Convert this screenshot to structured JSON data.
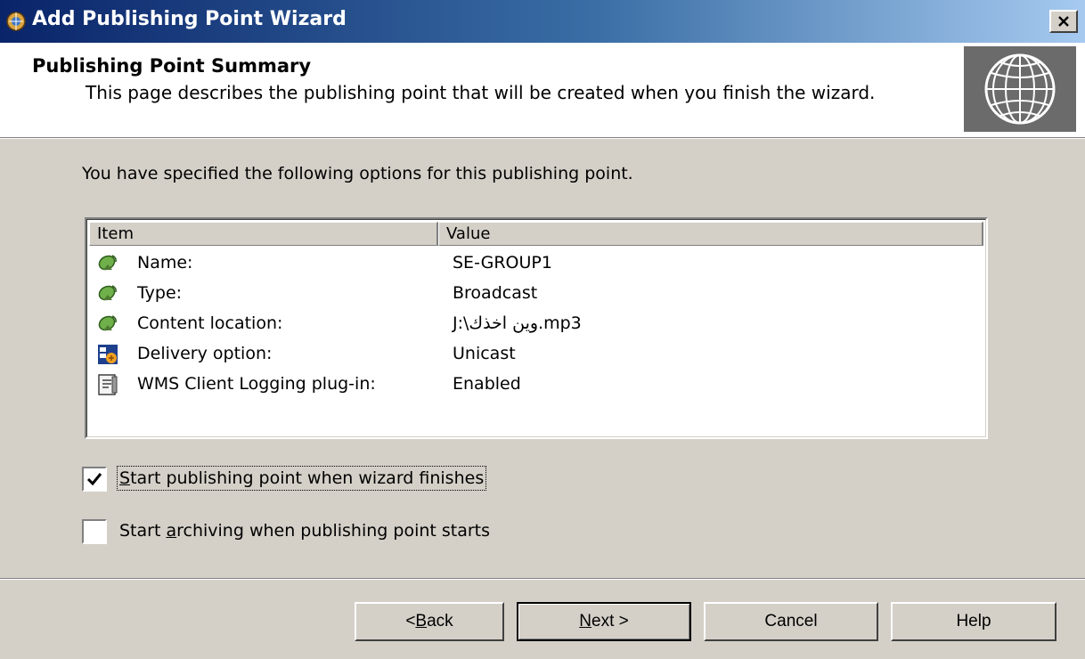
{
  "window": {
    "title": "Add Publishing Point Wizard",
    "close_label": "×"
  },
  "header": {
    "title": "Publishing Point Summary",
    "description": "This page describes the publishing point that will be created when you finish the wizard."
  },
  "intro_text": "You have specified the following options for this publishing point.",
  "summary_list": {
    "columns": [
      "Item",
      "Value"
    ],
    "rows": [
      {
        "label": "Name:",
        "value": "SE-GROUP1",
        "icon": "satellite-dish-icon"
      },
      {
        "label": "Type:",
        "value": "Broadcast",
        "icon": "satellite-dish-icon"
      },
      {
        "label": "Content location:",
        "value": "J:\\وين اخذك.mp3",
        "icon": "satellite-dish-icon"
      },
      {
        "label": "Delivery option:",
        "value": "Unicast",
        "icon": "delivery-option-icon"
      },
      {
        "label": "WMS Client Logging plug-in:",
        "value": "Enabled",
        "icon": "log-plugin-icon"
      }
    ]
  },
  "options": {
    "start_publishing": {
      "label_accel": "S",
      "label_rest": "tart publishing point when wizard finishes",
      "checked": true
    },
    "start_archiving": {
      "label_before": "Start ",
      "label_accel": "a",
      "label_rest": "rchiving when publishing point starts",
      "checked": false
    }
  },
  "buttons": {
    "back": {
      "prefix": "< ",
      "accel": "B",
      "rest": "ack"
    },
    "next": {
      "accel": "N",
      "rest": "ext >"
    },
    "cancel": "Cancel",
    "help": "Help"
  }
}
